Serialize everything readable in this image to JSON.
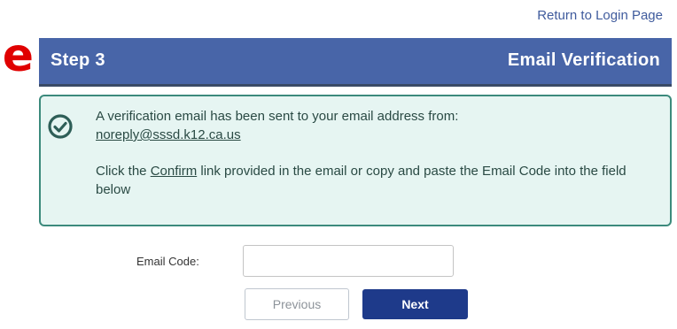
{
  "edge_fragment": "e",
  "header_link": {
    "label": "Return to Login Page"
  },
  "step": {
    "label": "Step 3",
    "title": "Email Verification"
  },
  "alert": {
    "line1": "A verification email has been sent to your email address from:",
    "sender_email": "noreply@sssd.k12.ca.us",
    "para2_before": "Click the ",
    "confirm_link": "Confirm",
    "para2_after": " link provided in the email or copy and paste the Email Code into the field below",
    "icon": "check-circle-icon"
  },
  "form": {
    "email_code_label": "Email Code:",
    "email_code_value": "",
    "email_code_placeholder": ""
  },
  "buttons": {
    "previous": "Previous",
    "next": "Next"
  },
  "colors": {
    "header_bg": "#4865a8",
    "alert_bg": "#e6f5f2",
    "alert_border": "#3c8a7c",
    "next_bg": "#1e3a8a",
    "link": "#3f5b9d",
    "edge_fragment": "#e00000"
  }
}
